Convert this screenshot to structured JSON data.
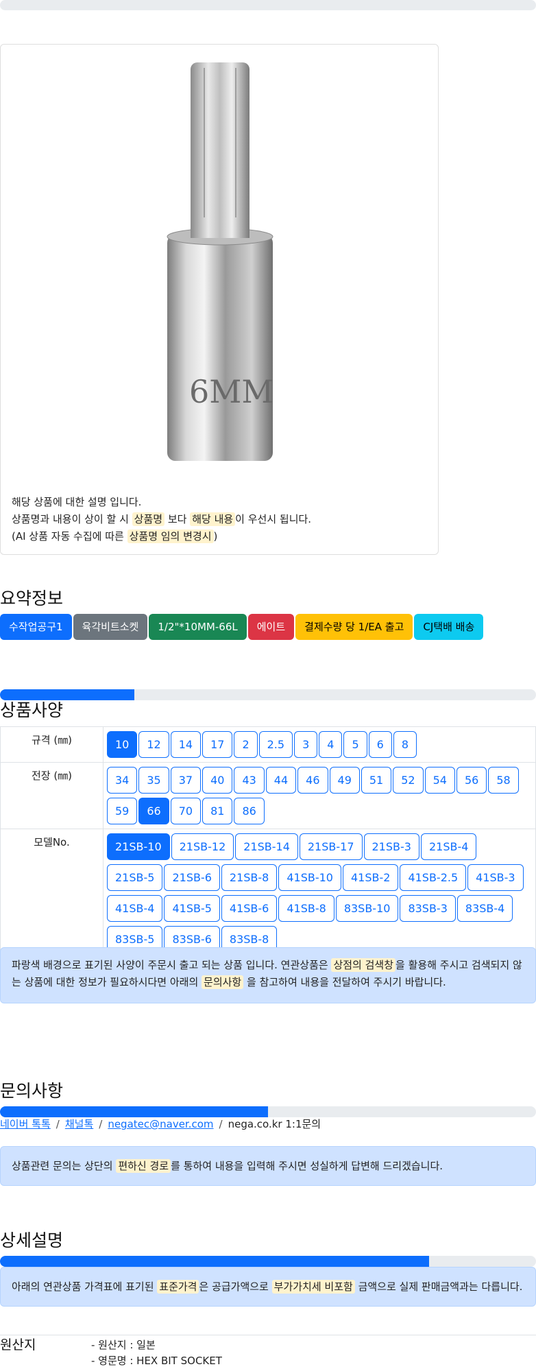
{
  "image_card": {
    "bit_marking": "6MM",
    "desc_line1": "해당 상품에 대한 설명 입니다.",
    "desc_line2_a": "상품명과 내용이 상이 할 시 ",
    "desc_line2_hl1": "상품명",
    "desc_line2_b": " 보다 ",
    "desc_line2_hl2": "해당 내용",
    "desc_line2_c": "이 우선시 됩니다.",
    "desc_line3_a": "(AI 상품 자동 수집에 따른 ",
    "desc_line3_hl": "상품명 임의 변경시",
    "desc_line3_b": ")"
  },
  "summary": {
    "title": "요약정보",
    "badges": [
      "수작업공구1",
      "육각비트소켓",
      "1/2\"*10MM-66L",
      "에이트",
      "결제수량 당 1/EA 출고",
      "CJ택배 배송"
    ]
  },
  "spec": {
    "title": "상품사양",
    "progress_fraction": 0.25,
    "rows": [
      {
        "label": "규격 (㎜)",
        "options": [
          "10",
          "12",
          "14",
          "17",
          "2",
          "2.5",
          "3",
          "4",
          "5",
          "6",
          "8"
        ],
        "selected": "10"
      },
      {
        "label": "전장 (㎜)",
        "options": [
          "34",
          "35",
          "37",
          "40",
          "43",
          "44",
          "46",
          "49",
          "51",
          "52",
          "54",
          "56",
          "58",
          "59",
          "66",
          "70",
          "81",
          "86"
        ],
        "selected": "66"
      },
      {
        "label": "모델No.",
        "options": [
          "21SB-10",
          "21SB-12",
          "21SB-14",
          "21SB-17",
          "21SB-3",
          "21SB-4",
          "21SB-5",
          "21SB-6",
          "21SB-8",
          "41SB-10",
          "41SB-2",
          "41SB-2.5",
          "41SB-3",
          "41SB-4",
          "41SB-5",
          "41SB-6",
          "41SB-8",
          "83SB-10",
          "83SB-3",
          "83SB-4",
          "83SB-5",
          "83SB-6",
          "83SB-8"
        ],
        "selected": "21SB-10"
      }
    ],
    "notice_a": "파랑색 배경으로 표기된 사양이 주문시 출고 되는 상품 입니다. 연관상품은 ",
    "notice_hl1": "상점의 검색창",
    "notice_b": "을 활용해 주시고 검색되지 않는 상품에 대한 정보가 필요하시다면 아래의 ",
    "notice_hl2": "문의사항",
    "notice_c": " 을 참고하여 내용을 전달하여 주시기 바랍니다."
  },
  "inquiry": {
    "title": "문의사항",
    "progress_fraction": 0.5,
    "link_naver": "네이버 톡톡",
    "link_channel": "채널톡",
    "link_email": "negatec@naver.com",
    "text_site": "nega.co.kr 1:1문의",
    "sep": "/",
    "notice_a": "상품관련 문의는 상단의 ",
    "notice_hl": "편하신 경로",
    "notice_b": "를 통하여 내용을 입력해 주시면 성실하게 답변해 드리겠습니다."
  },
  "detail": {
    "title": "상세설명",
    "progress_fraction": 0.8,
    "notice_a": "아래의 연관상품 가격표에 표기된 ",
    "notice_hl1": "표준가격",
    "notice_b": "은 공급가액으로 ",
    "notice_hl2": "부가가치세 비포함",
    "notice_c": " 금액으로 실제 판매금액과는 다릅니다."
  },
  "origin": {
    "title": "원산지",
    "items": [
      "- 원산지 : 일본",
      "- 영문명 : HEX BIT SOCKET"
    ]
  },
  "colors": {
    "primary": "#0d6efd",
    "secondary": "#6c757d",
    "success": "#198754",
    "danger": "#dc3545",
    "warning": "#ffc107",
    "info": "#0dcaf0",
    "highlight": "#fff3cd",
    "alert_bg": "#cfe2ff"
  }
}
